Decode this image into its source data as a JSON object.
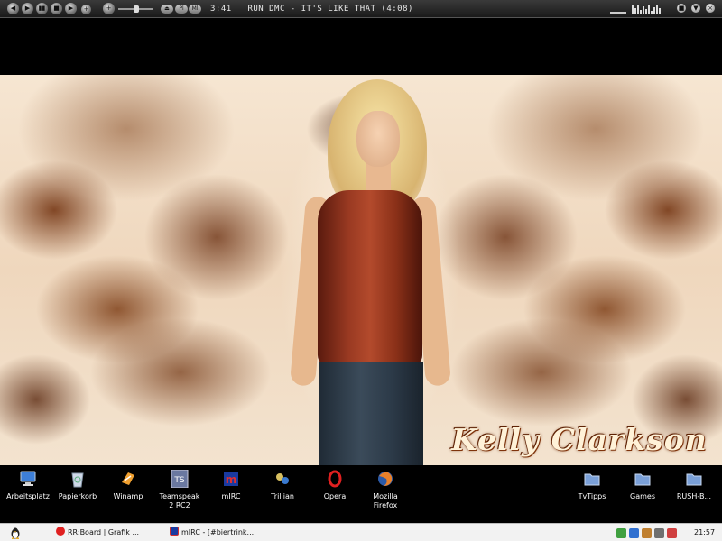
{
  "winamp": {
    "controls": [
      {
        "name": "prev",
        "glyph": "◀"
      },
      {
        "name": "play",
        "glyph": "▶"
      },
      {
        "name": "pause",
        "glyph": "▮▮"
      },
      {
        "name": "stop",
        "glyph": "■"
      },
      {
        "name": "next",
        "glyph": "▶"
      },
      {
        "name": "eject",
        "glyph": "+"
      }
    ],
    "toggle_pl": "Pl",
    "toggle_ml": "Ml",
    "track_time": "3:41",
    "track_title": "RUN DMC - IT'S LIKE THAT (4:08)",
    "window_buttons": [
      "■",
      "▼",
      "×"
    ]
  },
  "wallpaper": {
    "title": "Kelly Clarkson"
  },
  "desktop_icons": [
    {
      "label": "Arbeitsplatz",
      "icon": "computer-icon",
      "color": "#3d7fd8"
    },
    {
      "label": "Papierkorb",
      "icon": "recycle-bin-icon",
      "color": "#cfd8e8"
    },
    {
      "label": "Winamp",
      "icon": "winamp-icon",
      "color": "#f0a030"
    },
    {
      "label": "Teamspeak\n2 RC2",
      "icon": "teamspeak-icon",
      "color": "#6a78a0"
    },
    {
      "label": "mIRC",
      "icon": "mirc-icon",
      "color": "#d03030"
    },
    {
      "label": "Trillian",
      "icon": "trillian-icon",
      "color": "#d8c060"
    },
    {
      "label": "Opera",
      "icon": "opera-icon",
      "color": "#e02020"
    },
    {
      "label": "Mozilla\nFirefox",
      "icon": "firefox-icon",
      "color": "#e8802a"
    },
    {
      "label": "TvTipps",
      "icon": "folder-icon",
      "color": "#7aa0d8"
    },
    {
      "label": "Games",
      "icon": "folder-icon",
      "color": "#7aa0d8"
    },
    {
      "label": "RUSH-B...",
      "icon": "folder-icon",
      "color": "#7aa0d8"
    }
  ],
  "taskbar": {
    "start_icon": "tux-icon",
    "tasks": [
      {
        "label": "RR:Board | Grafik ...",
        "icon": "opera-icon",
        "color": "#e02020"
      },
      {
        "label": "mIRC - [#biertrink...",
        "icon": "mirc-icon",
        "color": "#d03030"
      }
    ],
    "tray_colors": [
      "#40a040",
      "#3070d0",
      "#c08030",
      "#707070",
      "#d04040"
    ],
    "clock": "21:57"
  }
}
